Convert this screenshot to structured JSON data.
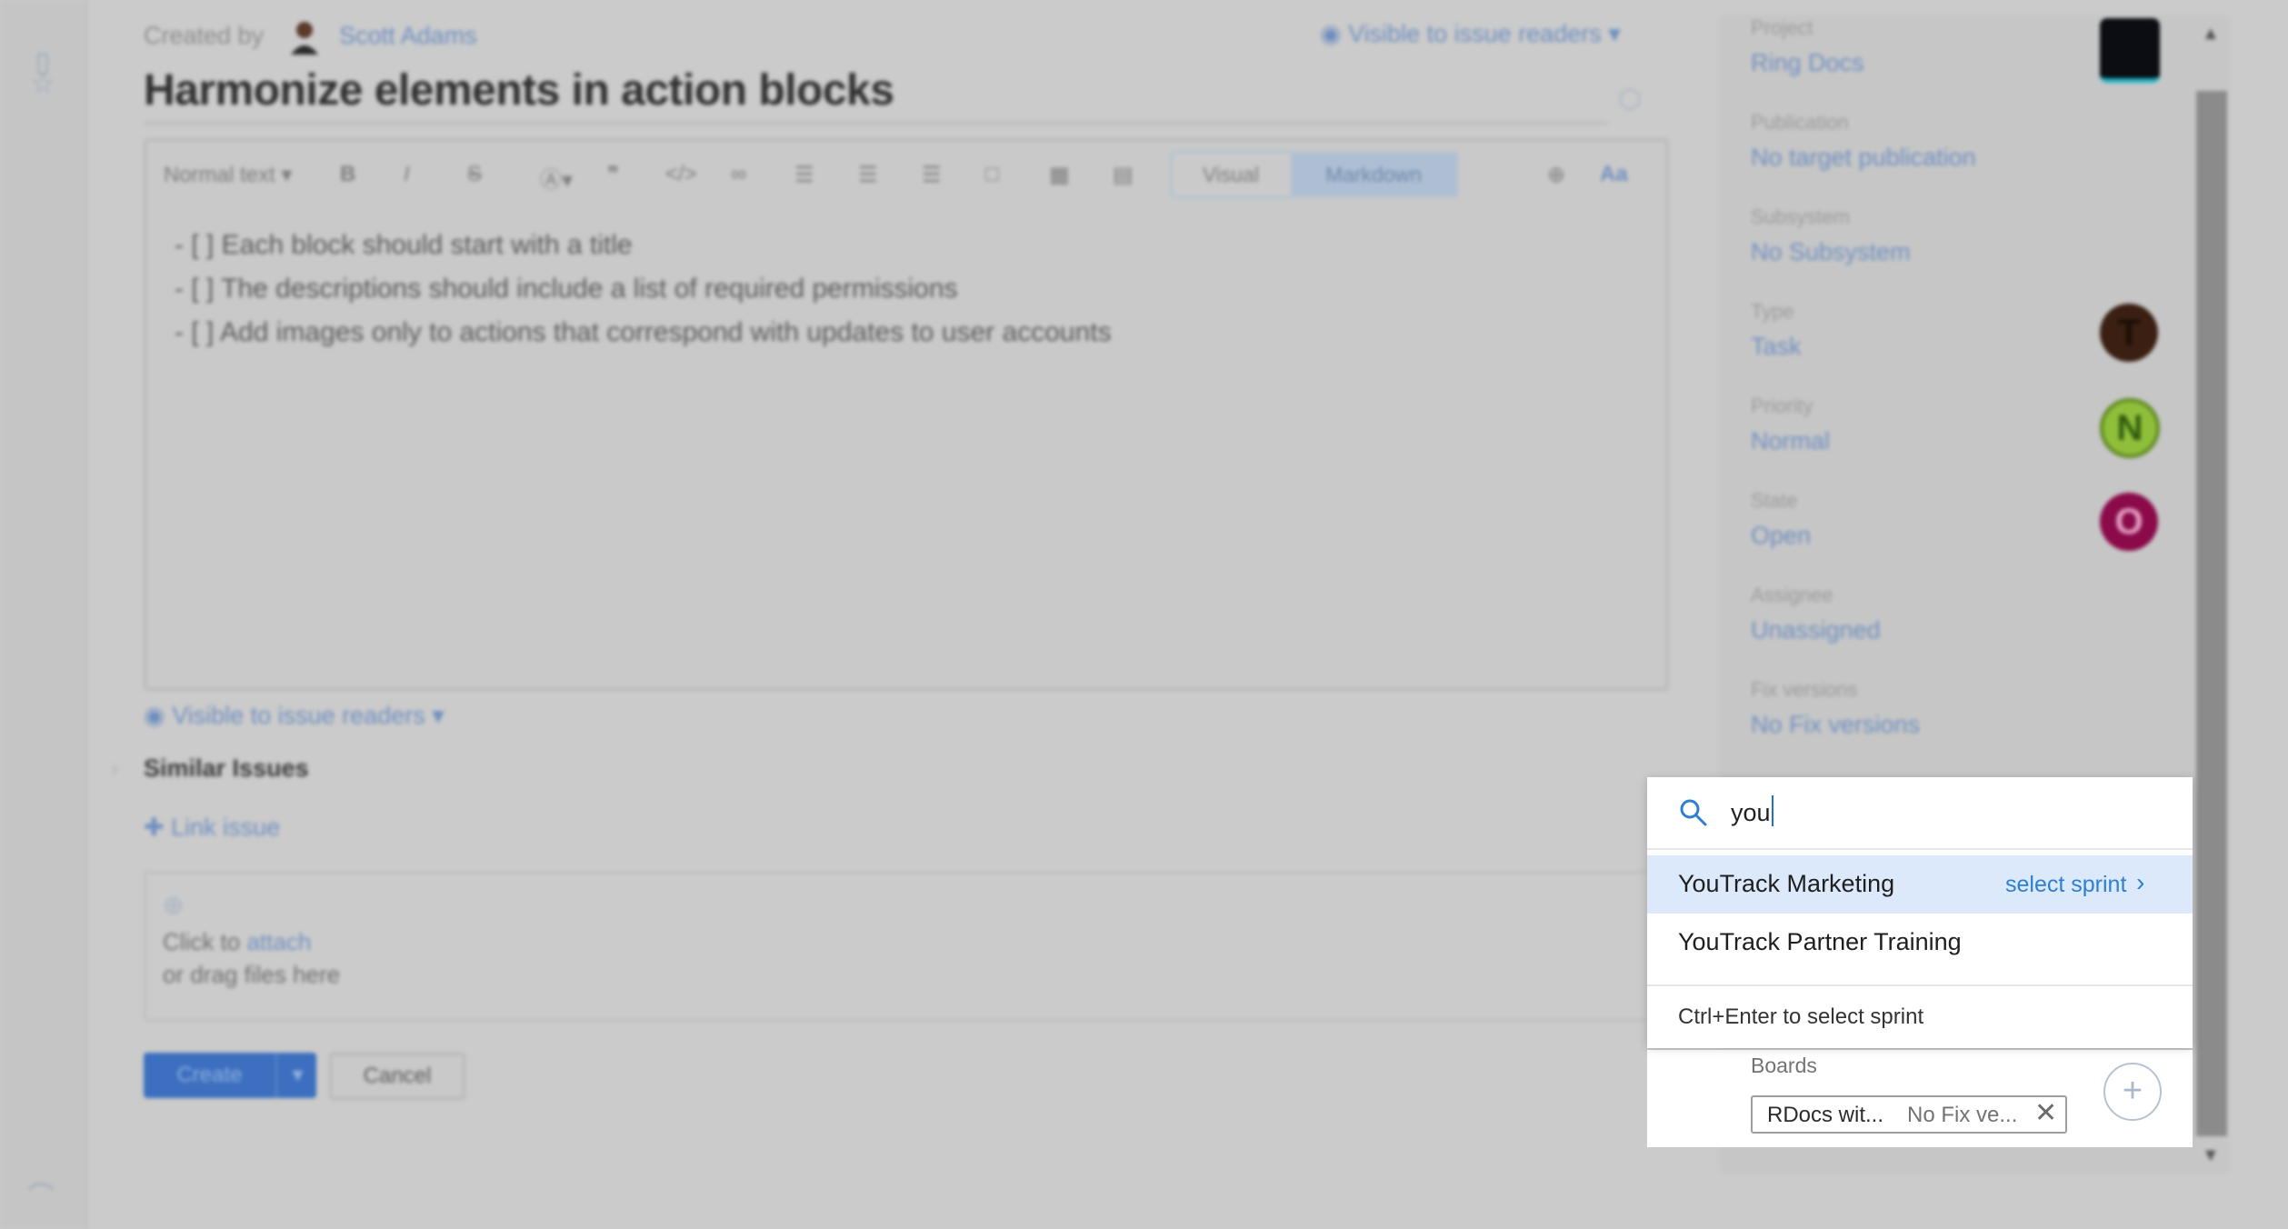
{
  "header": {
    "created_by_label": "Created by",
    "author": "Scott Adams",
    "visibility": "Visible to issue readers",
    "title": "Harmonize elements in action blocks"
  },
  "editor": {
    "text_style": "Normal text",
    "mode_visual": "Visual",
    "mode_markdown": "Markdown",
    "font_toggle": "Aa",
    "lines": [
      "- [ ] Each block should start with a title",
      "- [ ] The descriptions should include a list of required permissions",
      "- [ ] Add images only to actions that correspond with updates to user accounts"
    ]
  },
  "below_editor": {
    "visibility": "Visible to issue readers",
    "similar_issues": "Similar Issues",
    "link_issue": "Link issue",
    "attach_prefix": "Click to ",
    "attach_link": "attach",
    "attach_suffix": "or drag files here",
    "create_label": "Create",
    "cancel_label": "Cancel"
  },
  "side_panel": {
    "fields": [
      {
        "label": "Project",
        "value": "Ring Docs"
      },
      {
        "label": "Publication",
        "value": "No target publication"
      },
      {
        "label": "Subsystem",
        "value": "No Subsystem"
      },
      {
        "label": "Type",
        "value": "Task",
        "badge": "T",
        "badge_color": "#3a1f12"
      },
      {
        "label": "Priority",
        "value": "Normal",
        "badge": "N",
        "badge_color": "#8fbf3a"
      },
      {
        "label": "State",
        "value": "Open",
        "badge": "O",
        "badge_color": "#8a0a4a"
      },
      {
        "label": "Assignee",
        "value": "Unassigned"
      },
      {
        "label": "Fix versions",
        "value": "No Fix versions"
      }
    ],
    "boards_label": "Boards",
    "board_chip_name": "RDocs wit...",
    "board_chip_fix": "No Fix ve..."
  },
  "popup": {
    "search_value": "you",
    "options": [
      {
        "label": "YouTrack Marketing",
        "action": "select sprint"
      },
      {
        "label": "YouTrack Partner Training"
      }
    ],
    "hint": "Ctrl+Enter to select sprint"
  },
  "colors": {
    "accent": "#2e7fd0",
    "highlight_row": "#dbe9fb",
    "overlay_background": "#cbcbcb"
  }
}
